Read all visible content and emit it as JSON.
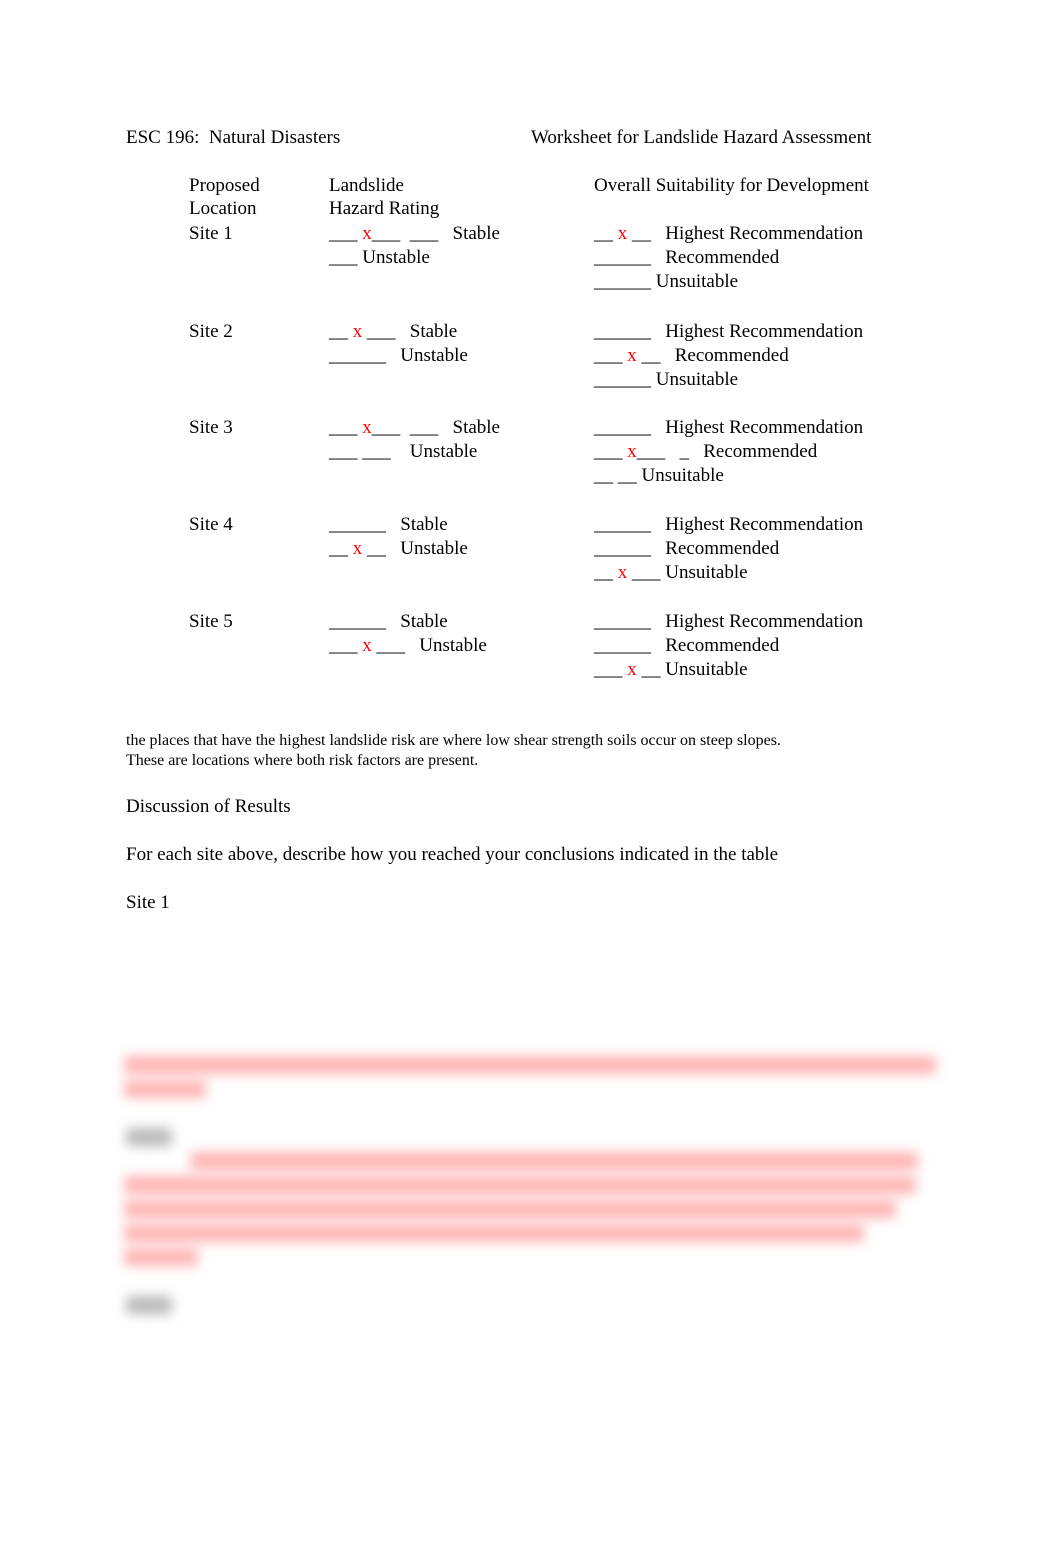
{
  "header": {
    "course": "ESC 196:  Natural Disasters",
    "title": "Worksheet for Landslide Hazard Assessment"
  },
  "table": {
    "col_location": [
      "Proposed",
      "Location"
    ],
    "col_hazard": [
      "Landslide",
      "Hazard Rating"
    ],
    "col_suitability": "Overall Suitability for Development",
    "mark_color": "#ff0000",
    "sites": [
      {
        "name": "Site 1",
        "hazard": [
          {
            "pre": "___ ",
            "mark": "x",
            "post": "___  ___   Stable"
          },
          {
            "pre": "___ Unstable",
            "mark": "",
            "post": ""
          }
        ],
        "suitability": [
          {
            "pre": "__ ",
            "mark": "x",
            "post": " __   Highest Recommendation"
          },
          {
            "pre": "______   Recommended",
            "mark": "",
            "post": ""
          },
          {
            "pre": "______ Unsuitable",
            "mark": "",
            "post": ""
          }
        ],
        "hazard_selected": "Stable",
        "suitability_selected": "Highest Recommendation"
      },
      {
        "name": "Site 2",
        "hazard": [
          {
            "pre": "__ ",
            "mark": "x",
            "post": " ___   Stable"
          },
          {
            "pre": "______   Unstable",
            "mark": "",
            "post": ""
          }
        ],
        "suitability": [
          {
            "pre": "______   Highest Recommendation",
            "mark": "",
            "post": ""
          },
          {
            "pre": "___ ",
            "mark": "x",
            "post": " __   Recommended"
          },
          {
            "pre": "______ Unsuitable",
            "mark": "",
            "post": ""
          }
        ],
        "hazard_selected": "Stable",
        "suitability_selected": "Recommended"
      },
      {
        "name": "Site 3",
        "hazard": [
          {
            "pre": "___ ",
            "mark": "x",
            "post": "___  ___   Stable"
          },
          {
            "pre": "___ ___    Unstable",
            "mark": "",
            "post": ""
          }
        ],
        "suitability": [
          {
            "pre": "______   Highest Recommendation",
            "mark": "",
            "post": ""
          },
          {
            "pre": "___ ",
            "mark": "x",
            "post": "___   _   Recommended"
          },
          {
            "pre": "__ __ Unsuitable",
            "mark": "",
            "post": ""
          }
        ],
        "hazard_selected": "Stable",
        "suitability_selected": "Recommended"
      },
      {
        "name": "Site 4",
        "hazard": [
          {
            "pre": "______   Stable",
            "mark": "",
            "post": ""
          },
          {
            "pre": "__ ",
            "mark": "x",
            "post": " __   Unstable"
          }
        ],
        "suitability": [
          {
            "pre": "______   Highest Recommendation",
            "mark": "",
            "post": ""
          },
          {
            "pre": "______   Recommended",
            "mark": "",
            "post": ""
          },
          {
            "pre": "__ ",
            "mark": "x",
            "post": " ___ Unsuitable"
          }
        ],
        "hazard_selected": "Unstable",
        "suitability_selected": "Unsuitable"
      },
      {
        "name": "Site 5",
        "hazard": [
          {
            "pre": "______   Stable",
            "mark": "",
            "post": ""
          },
          {
            "pre": "___ ",
            "mark": "x",
            "post": " ___   Unstable"
          }
        ],
        "suitability": [
          {
            "pre": "______   Highest Recommendation",
            "mark": "",
            "post": ""
          },
          {
            "pre": "______   Recommended",
            "mark": "",
            "post": ""
          },
          {
            "pre": "___ ",
            "mark": "x",
            "post": " __ Unsuitable"
          }
        ],
        "hazard_selected": "Unstable",
        "suitability_selected": "Unsuitable"
      }
    ]
  },
  "note": [
    "the places that have the highest landslide risk are where low shear strength soils occur on steep slopes.",
    "These are locations where both risk factors are present."
  ],
  "discussion": {
    "heading": "Discussion of Results",
    "prompt": "For each site above, describe how you reached your conclusions indicated in the table",
    "site1_label": "Site 1"
  },
  "redacted": {
    "note": "blurred content"
  }
}
